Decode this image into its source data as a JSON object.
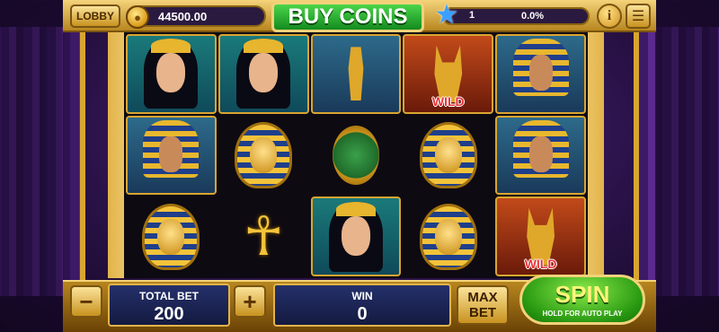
{
  "header": {
    "lobby_label": "LOBBY",
    "coin_symbol": "●",
    "balance": "44500.00",
    "buy_coins_label": "BUY COINS",
    "level": "1",
    "level_progress_percent": 0,
    "level_progress_text": "0.0%",
    "info_label": "i",
    "menu_symbol": "☰"
  },
  "reels": {
    "symbols": [
      [
        "queen",
        "pharaoh-king",
        "pharaoh-mask"
      ],
      [
        "queen",
        "pharaoh-mask",
        "ankh"
      ],
      [
        "horus-statue",
        "scarab",
        "queen"
      ],
      [
        "anubis-wild",
        "pharaoh-mask",
        "pharaoh-mask"
      ],
      [
        "pharaoh-king",
        "pharaoh-king",
        "anubis-wild"
      ]
    ],
    "wild_label": "WILD"
  },
  "footer": {
    "minus_label": "−",
    "plus_label": "+",
    "total_bet_label": "TOTAL BET",
    "total_bet_value": "200",
    "win_label": "WIN",
    "win_value": "0",
    "max_label_1": "MAX",
    "max_label_2": "BET",
    "spin_label": "SPIN",
    "spin_sub": "HOLD FOR AUTO PLAY"
  },
  "colors": {
    "frame_gold": "#e2b34a",
    "spin_green": "#2a9a12",
    "buy_green": "#138a1e",
    "panel_blue": "#1c2555",
    "backdrop_purple": "#3d1a66"
  }
}
